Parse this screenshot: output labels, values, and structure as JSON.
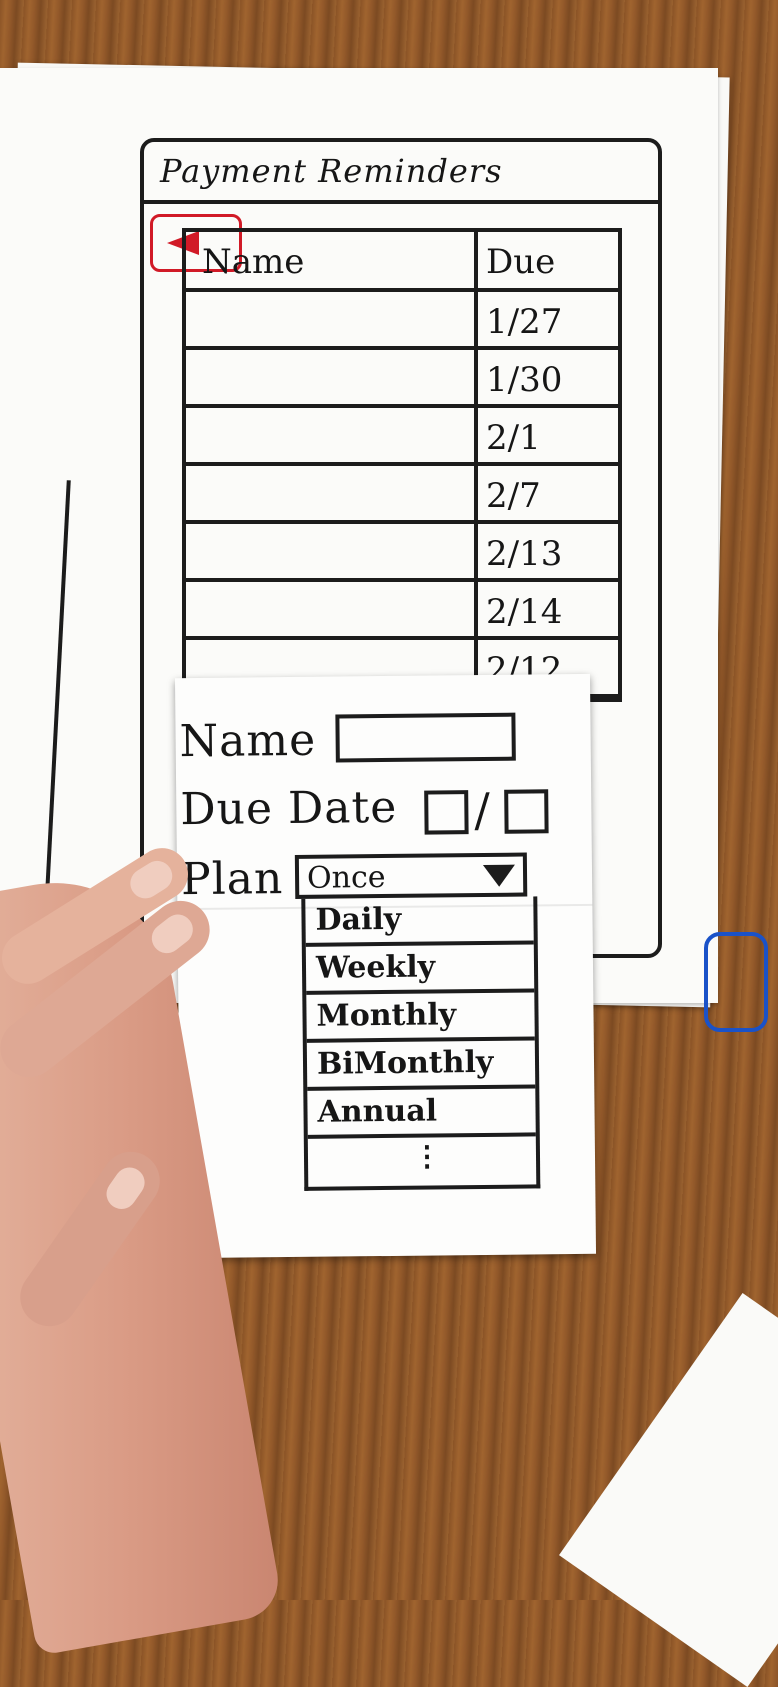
{
  "app": {
    "title": "Payment Reminders"
  },
  "toolbar": {
    "back_icon": "triangle-left-icon"
  },
  "table": {
    "headers": [
      "Name",
      "Due"
    ],
    "rows": [
      {
        "name": "",
        "due": "1/27"
      },
      {
        "name": "",
        "due": "1/30"
      },
      {
        "name": "",
        "due": "2/1"
      },
      {
        "name": "",
        "due": "2/7"
      },
      {
        "name": "",
        "due": "2/13"
      },
      {
        "name": "",
        "due": "2/14"
      },
      {
        "name": "",
        "due": "2/12"
      }
    ]
  },
  "form": {
    "name_label": "Name",
    "name_value": "",
    "due_label": "Due Date",
    "due_separator": "/",
    "plan_label": "Plan",
    "plan_selected": "Once",
    "plan_options": [
      "Daily",
      "Weekly",
      "Monthly",
      "BiMonthly",
      "Annual"
    ],
    "more_indicator": "⋮"
  },
  "colors": {
    "ink": "#1c1c1c",
    "back_accent": "#d11a27",
    "fab_accent": "#1a52c8"
  }
}
